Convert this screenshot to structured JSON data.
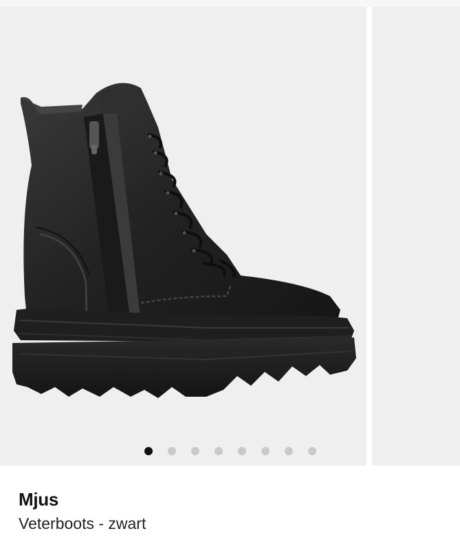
{
  "product": {
    "brand": "Mjus",
    "subtitle": "Veterboots - zwart",
    "image_label": "black-leather-lace-up-boot"
  },
  "carousel": {
    "slide_count": 8,
    "active_index": 0
  },
  "colors": {
    "image_background": "#efefef",
    "dot_active": "#111111",
    "dot_inactive": "#c9c9c9",
    "boot_leather": "#262626",
    "boot_sole": "#1c1c1c"
  }
}
